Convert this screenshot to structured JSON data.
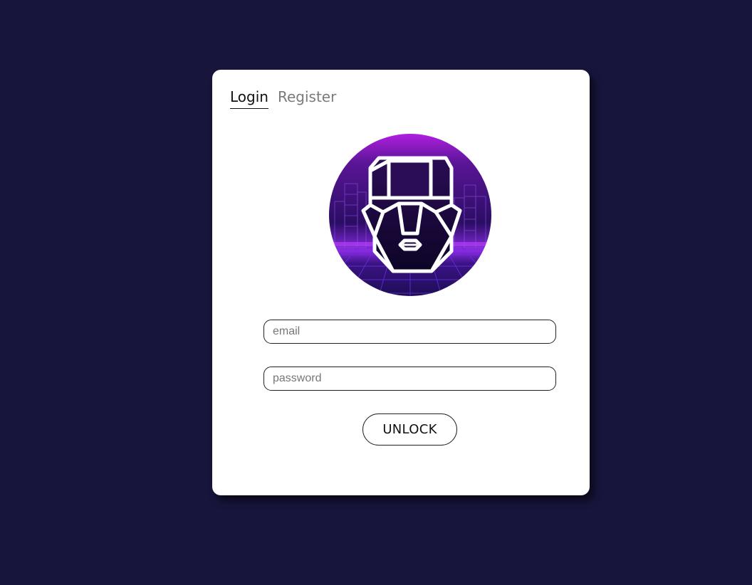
{
  "tabs": {
    "login_label": "Login",
    "register_label": "Register",
    "active": "Login"
  },
  "form": {
    "email_placeholder": "email",
    "email_value": "",
    "password_placeholder": "password",
    "password_value": "",
    "unlock_label": "UNLOCK"
  },
  "avatar": {
    "icon": "robot-face-icon"
  },
  "colors": {
    "background": "#17153b",
    "card": "#ffffff",
    "avatar_accent": "#a020e0",
    "avatar_dark": "#1a0b3d"
  }
}
